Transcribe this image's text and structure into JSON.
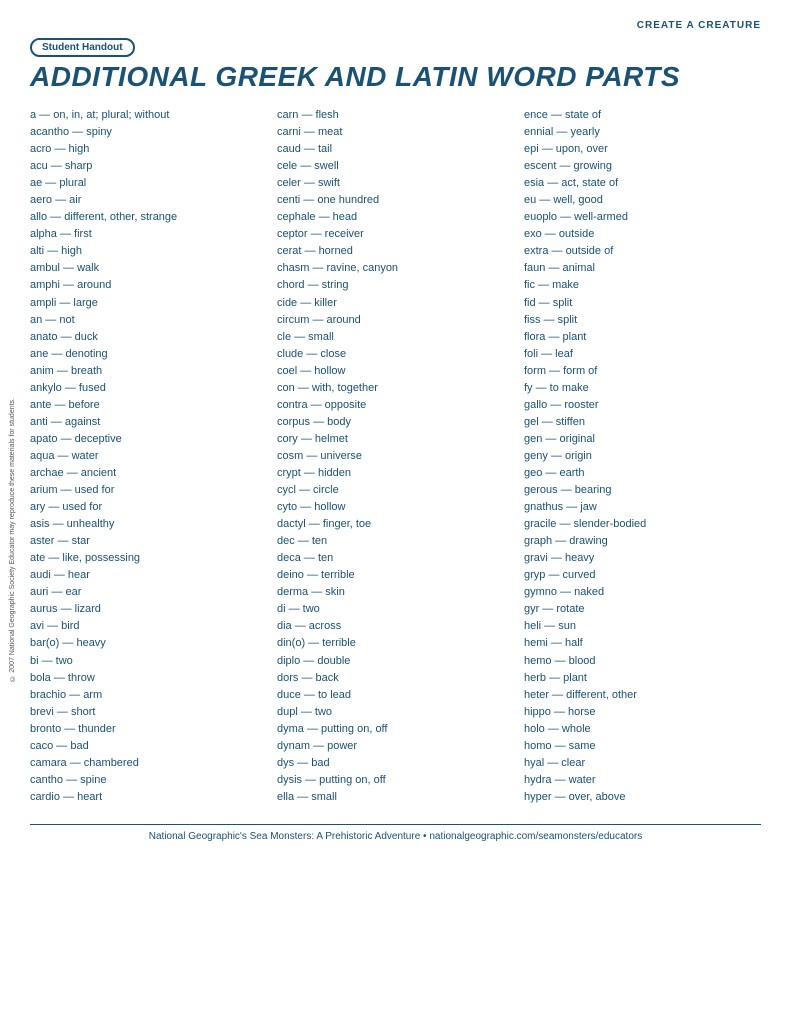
{
  "header": {
    "top_right": "CREATE A CREATURE",
    "badge": "Student Handout",
    "title": "ADDITIONAL GREEK AND LATIN WORD PARTS"
  },
  "col1": [
    "a — on, in, at; plural; without",
    "acantho — spiny",
    "acro — high",
    "acu — sharp",
    "ae — plural",
    "aero — air",
    "allo — different, other, strange",
    "alpha — first",
    "alti — high",
    "ambul — walk",
    "amphi — around",
    "ampli — large",
    "an — not",
    "anato — duck",
    "ane — denoting",
    "anim — breath",
    "ankylo — fused",
    "ante — before",
    "anti — against",
    "apato — deceptive",
    "aqua — water",
    "archae — ancient",
    "arium — used for",
    "ary — used for",
    "asis — unhealthy",
    "aster — star",
    "ate — like, possessing",
    "audi — hear",
    "auri — ear",
    "aurus — lizard",
    "avi — bird",
    "bar(o) — heavy",
    "bi — two",
    "bola — throw",
    "brachio — arm",
    "brevi — short",
    "bronto — thunder",
    "caco — bad",
    "camara — chambered",
    "cantho — spine",
    "cardio — heart"
  ],
  "col2": [
    "carn — flesh",
    "carni — meat",
    "caud — tail",
    "cele — swell",
    "celer — swift",
    "centi — one hundred",
    "cephale — head",
    "ceptor — receiver",
    "cerat — horned",
    "chasm — ravine, canyon",
    "chord — string",
    "cide — killer",
    "circum — around",
    "cle — small",
    "clude — close",
    "coel — hollow",
    "con — with, together",
    "contra — opposite",
    "corpus — body",
    "cory — helmet",
    "cosm — universe",
    "crypt — hidden",
    "cycl — circle",
    "cyto — hollow",
    "dactyl — finger, toe",
    "dec — ten",
    "deca — ten",
    "deino — terrible",
    "derma — skin",
    "di — two",
    "dia — across",
    "din(o) — terrible",
    "diplo — double",
    "dors — back",
    "duce — to lead",
    "dupl — two",
    "dyma — putting on, off",
    "dynam — power",
    "dys — bad",
    "dysis — putting on, off",
    "ella — small"
  ],
  "col3": [
    "ence — state of",
    "ennial — yearly",
    "epi — upon, over",
    "escent — growing",
    "esia — act, state of",
    "eu — well, good",
    "euoplo — well-armed",
    "exo — outside",
    "extra — outside of",
    "faun — animal",
    "fic — make",
    "fid — split",
    "fiss — split",
    "flora — plant",
    "foli — leaf",
    "form — form of",
    "fy — to make",
    "gallo — rooster",
    "gel — stiffen",
    "gen — original",
    "geny — origin",
    "geo — earth",
    "gerous — bearing",
    "gnathus — jaw",
    "gracile — slender-bodied",
    "graph — drawing",
    "gravi — heavy",
    "gryp — curved",
    "gymno — naked",
    "gyr — rotate",
    "heli — sun",
    "hemi — half",
    "hemo — blood",
    "herb — plant",
    "heter — different, other",
    "hippo — horse",
    "holo — whole",
    "homo — same",
    "hyal — clear",
    "hydra — water",
    "hyper — over, above"
  ],
  "side_text": "© 2007 National Geographic Society\nEducator may reproduce these materials for students.",
  "footer": "National Geographic's Sea Monsters: A Prehistoric Adventure • nationalgeographic.com/seamonsters/educators"
}
